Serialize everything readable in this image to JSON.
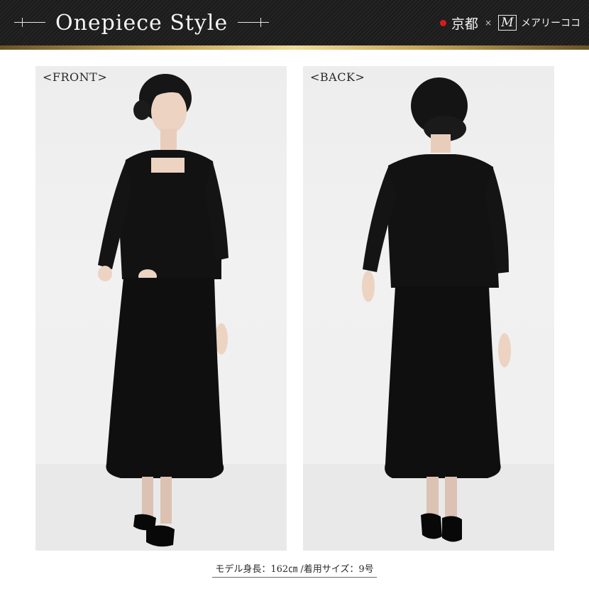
{
  "header": {
    "title": "Onepiece Style",
    "brand_kyoto": "京都",
    "brand_times": "×",
    "brand_logo_letter": "M",
    "brand_name": "メアリーココ",
    "accent_dot_color": "#d91a1a",
    "gold_color": "#c9a95a"
  },
  "panels": {
    "front_label": "<FRONT>",
    "back_label": "<BACK>"
  },
  "caption": "モデル身長：162㎝ /着用サイズ：9号"
}
